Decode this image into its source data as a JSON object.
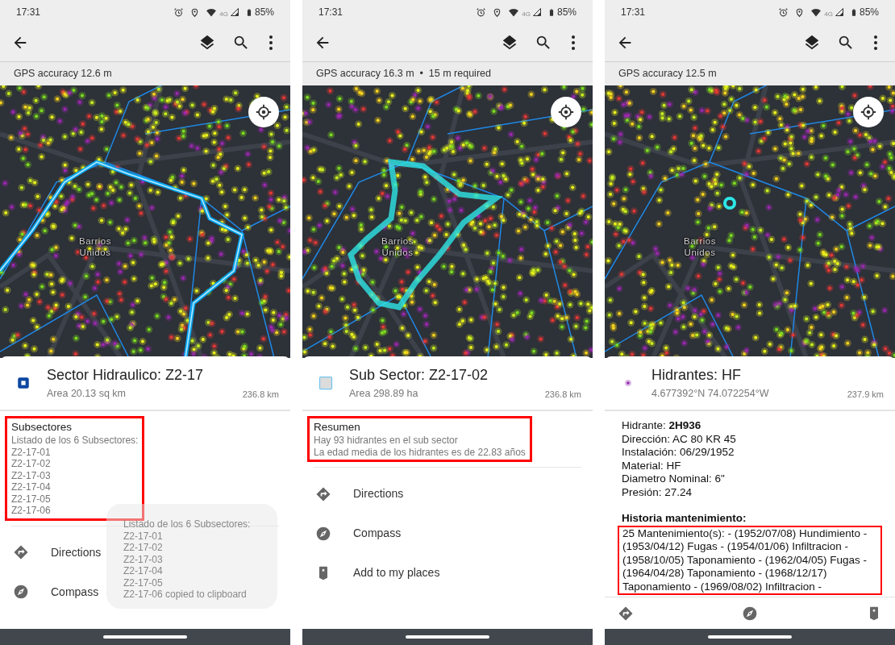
{
  "panels": [
    {
      "kind": "sector",
      "status_bar": {
        "time": "17:31",
        "network": "4G",
        "battery": "85%"
      },
      "gps_accuracy": "GPS accuracy 12.6 m",
      "map_label": "Barrios Unidos",
      "feature": {
        "title": "Sector Hidraulico: Z2-17",
        "subtitle": "Area 20.13 sq km",
        "distance": "236.8 km"
      },
      "section": {
        "heading": "Subsectores",
        "lines": [
          "Listado de los 6 Subsectores:",
          "Z2-17-01",
          "Z2-17-02",
          "Z2-17-03",
          "Z2-17-04",
          "Z2-17-05",
          "Z2-17-06"
        ]
      },
      "actions": [
        {
          "kind": "directions",
          "label": "Directions"
        },
        {
          "kind": "compass",
          "label": "Compass"
        }
      ],
      "toast": {
        "lines": [
          "Listado de los 6 Subsectores:",
          "Z2-17-01",
          "Z2-17-02",
          "Z2-17-03",
          "Z2-17-04",
          "Z2-17-05",
          "Z2-17-06 copied to clipboard"
        ]
      }
    },
    {
      "kind": "subsector",
      "status_bar": {
        "time": "17:31",
        "network": "4G",
        "battery": "85%"
      },
      "gps_accuracy": "GPS accuracy 16.3 m  •  15 m required",
      "map_label": "Barrios Unidos",
      "feature": {
        "title": "Sub Sector: Z2-17-02",
        "subtitle": "Area 298.89 ha",
        "distance": "236.8 km"
      },
      "section": {
        "heading": "Resumen",
        "lines": [
          "Hay 93 hidrantes en el sub sector",
          "La edad media de los hidrantes es de 22.83 años"
        ]
      },
      "actions": [
        {
          "kind": "directions",
          "label": "Directions"
        },
        {
          "kind": "compass",
          "label": "Compass"
        },
        {
          "kind": "place",
          "label": "Add to my places"
        }
      ]
    },
    {
      "kind": "point",
      "status_bar": {
        "time": "17:31",
        "network": "4G",
        "battery": "85%"
      },
      "gps_accuracy": "GPS accuracy 12.5 m",
      "map_label": "Barrios Unidos",
      "feature": {
        "title": "Hidrantes: HF",
        "subtitle": "4.677392°N  74.072254°W",
        "distance": "237.9 km"
      },
      "details": [
        "Hidrante: **2H936**",
        "Dirección: AC 80 KR 45",
        "Instalación: 06/29/1952",
        "Material: HF",
        "Diametro Nominal: 6\"",
        "Presión: 27.24"
      ],
      "history_heading": "Historia mantenimiento:",
      "history": "25 Mantenimiento(s): - (1952/07/08) Hundimiento - (1953/04/12) Fugas - (1954/01/06) Infiltracion - (1958/10/05) Taponamiento - (1962/04/05) Fugas - (1964/04/28) Taponamiento - (1968/12/17) Taponamiento - (1969/08/02) Infiltracion -",
      "action_icons": [
        {
          "kind": "directions"
        },
        {
          "kind": "compass"
        },
        {
          "kind": "place"
        }
      ]
    }
  ]
}
